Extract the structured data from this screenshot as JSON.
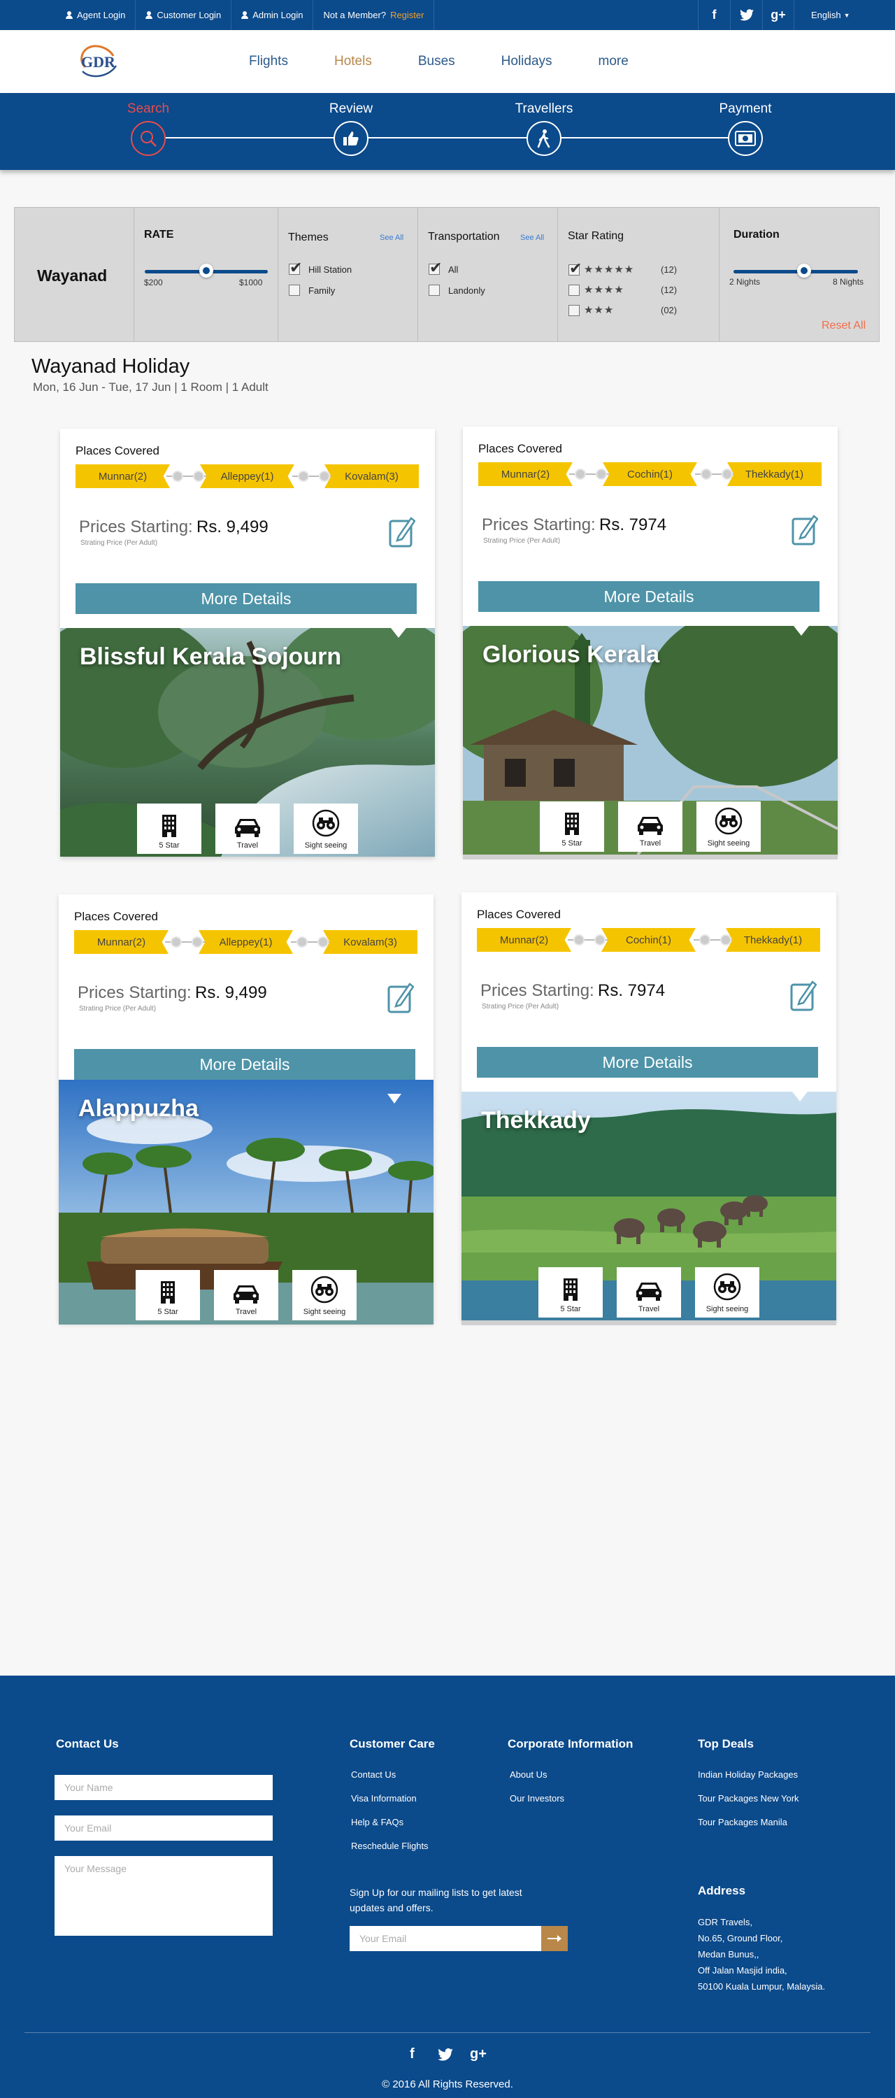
{
  "topbar": {
    "links": [
      "Agent Login",
      "Customer Login",
      "Admin Login"
    ],
    "member_text": "Not a Member?",
    "register": "Register",
    "social": [
      "f",
      "t",
      "g+"
    ],
    "language": "English"
  },
  "nav": {
    "items": [
      "Flights",
      "Hotels",
      "Buses",
      "Holidays",
      "more"
    ],
    "active": "Hotels"
  },
  "steps": [
    "Search",
    "Review",
    "Travellers",
    "Payment"
  ],
  "filters": {
    "location": "Wayanad",
    "rate": {
      "title": "RATE",
      "min_label": "$200",
      "max_label": "$1000",
      "value_fraction": 0.5
    },
    "themes": {
      "title": "Themes",
      "see_all": "See All",
      "options": [
        {
          "label": "Hill Station",
          "checked": true
        },
        {
          "label": "Family",
          "checked": false
        }
      ]
    },
    "transport": {
      "title": "Transportation",
      "see_all": "See All",
      "options": [
        {
          "label": "All",
          "checked": true
        },
        {
          "label": "Landonly",
          "checked": false
        }
      ]
    },
    "stars": {
      "title": "Star Rating",
      "options": [
        {
          "stars": 5,
          "count": "(12)",
          "checked": true
        },
        {
          "stars": 4,
          "count": "(12)",
          "checked": false
        },
        {
          "stars": 3,
          "count": "(02)",
          "checked": false
        }
      ]
    },
    "duration": {
      "title": "Duration",
      "min_label": "2 Nights",
      "max_label": "8 Nights",
      "value_fraction": 0.57
    },
    "reset": "Reset All"
  },
  "page": {
    "title": "Wayanad Holiday",
    "subtitle": "Mon, 16 Jun - Tue, 17 Jun | 1 Room | 1 Adult"
  },
  "packages": [
    {
      "places_label": "Places Covered",
      "places": [
        "Munnar(2)",
        "Alleppey(1)",
        "Kovalam(3)"
      ],
      "prices_label": "Prices Starting:",
      "price": "Rs. 9,499",
      "price_sub": "Strating Price (Per Adult)",
      "more": "More Details",
      "name": "Blissful Kerala Sojourn",
      "features": [
        "5 Star",
        "Travel",
        "Sight seeing"
      ]
    },
    {
      "places_label": "Places Covered",
      "places": [
        "Munnar(2)",
        "Cochin(1)",
        "Thekkady(1)"
      ],
      "prices_label": "Prices Starting:",
      "price": "Rs. 7974",
      "price_sub": "Strating Price (Per Adult)",
      "more": "More Details",
      "name": "Glorious Kerala",
      "features": [
        "5 Star",
        "Travel",
        "Sight seeing"
      ]
    },
    {
      "places_label": "Places Covered",
      "places": [
        "Munnar(2)",
        "Alleppey(1)",
        "Kovalam(3)"
      ],
      "prices_label": "Prices Starting:",
      "price": "Rs. 9,499",
      "price_sub": "Strating Price (Per Adult)",
      "more": "More Details",
      "name": "Alappuzha",
      "features": [
        "5 Star",
        "Travel",
        "Sight seeing"
      ]
    },
    {
      "places_label": "Places Covered",
      "places": [
        "Munnar(2)",
        "Cochin(1)",
        "Thekkady(1)"
      ],
      "prices_label": "Prices Starting:",
      "price": "Rs. 7974",
      "price_sub": "Strating Price (Per Adult)",
      "more": "More Details",
      "name": "Thekkady",
      "features": [
        "5 Star",
        "Travel",
        "Sight seeing"
      ]
    }
  ],
  "footer": {
    "contact": {
      "title": "Contact Us",
      "name_ph": "Your Name",
      "email_ph": "Your Email",
      "message_ph": "Your Message"
    },
    "care": {
      "title": "Customer Care",
      "links": [
        "Contact Us",
        "Visa Information",
        "Help & FAQs",
        "Reschedule Flights"
      ]
    },
    "corporate": {
      "title": "Corporate Information",
      "links": [
        "About Us",
        "Our Investors"
      ]
    },
    "deals": {
      "title": "Top Deals",
      "links": [
        "Indian Holiday Packages",
        "Tour Packages New York",
        "Tour Packages Manila"
      ]
    },
    "signup": {
      "text1": "Sign Up for our mailing lists to get latest",
      "text2": "updates and offers.",
      "email_ph": "Your Email"
    },
    "address": {
      "title": "Address",
      "lines": [
        "GDR Travels,",
        "No.65, Ground Floor,",
        "Medan Bunus,,",
        "Off Jalan Masjid india,",
        "50100 Kuala Lumpur, Malaysia."
      ]
    },
    "social": [
      "f",
      "t",
      "g+"
    ],
    "copyright": "2016 All Rights Reserved."
  }
}
